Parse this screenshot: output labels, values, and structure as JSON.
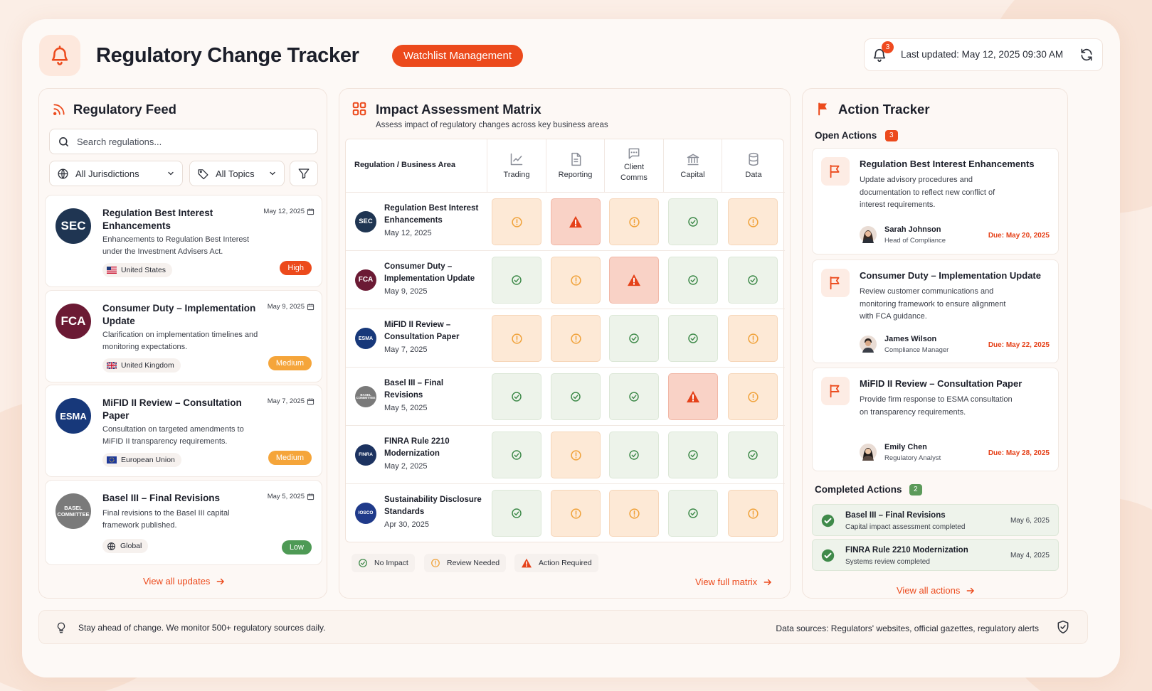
{
  "header": {
    "title": "Regulatory Change Tracker",
    "pill": "Watchlist Management",
    "notification_count": "3",
    "last_updated": "Last updated: May 12, 2025 09:30 AM"
  },
  "feed": {
    "title": "Regulatory Feed",
    "search_placeholder": "Search regulations...",
    "jurisdiction_filter": "All Jurisdictions",
    "topic_filter": "All Topics",
    "items": [
      {
        "logo": "SEC",
        "title": "Regulation Best Interest Enhancements",
        "date": "May 12, 2025",
        "desc": "Enhancements to Regulation Best Interest under the Investment Advisers Act.",
        "region": "United States",
        "severity": "High"
      },
      {
        "logo": "FCA",
        "title": "Consumer Duty – Implementation Update",
        "date": "May 9, 2025",
        "desc": "Clarification on implementation timelines and monitoring expectations.",
        "region": "United Kingdom",
        "severity": "Medium"
      },
      {
        "logo": "ESMA",
        "title": "MiFID II Review – Consultation Paper",
        "date": "May 7, 2025",
        "desc": "Consultation on targeted amendments to MiFID II transparency requirements.",
        "region": "European Union",
        "severity": "Medium"
      },
      {
        "logo": "BASEL COMMITTEE",
        "title": "Basel III – Final Revisions",
        "date": "May 5, 2025",
        "desc": "Final revisions to the Basel III capital framework published.",
        "region": "Global",
        "severity": "Low"
      }
    ],
    "view_all": "View all updates"
  },
  "matrix": {
    "title": "Impact Assessment Matrix",
    "subtitle": "Assess impact of regulatory changes across key business areas",
    "corner_header": "Regulation / Business Area",
    "columns": [
      {
        "label": "Trading",
        "icon": "trend-icon"
      },
      {
        "label": "Reporting",
        "icon": "document-icon"
      },
      {
        "label": "Client Comms",
        "icon": "chat-icon"
      },
      {
        "label": "Capital",
        "icon": "bank-icon"
      },
      {
        "label": "Data",
        "icon": "database-icon"
      }
    ],
    "rows": [
      {
        "logo": "SEC",
        "name": "Regulation Best Interest Enhancements",
        "date": "May 12, 2025",
        "impacts": [
          "review",
          "action",
          "review",
          "none",
          "review"
        ]
      },
      {
        "logo": "FCA",
        "name": "Consumer Duty – Implementation Update",
        "date": "May 9, 2025",
        "impacts": [
          "none",
          "review",
          "action",
          "none",
          "none"
        ]
      },
      {
        "logo": "ESMA",
        "name": "MiFID II Review – Consultation Paper",
        "date": "May 7, 2025",
        "impacts": [
          "review",
          "review",
          "none",
          "none",
          "review"
        ]
      },
      {
        "logo": "BASEL COMMITTEE",
        "name": "Basel III – Final Revisions",
        "date": "May 5, 2025",
        "impacts": [
          "none",
          "none",
          "none",
          "action",
          "review"
        ]
      },
      {
        "logo": "FINRA",
        "name": "FINRA Rule 2210 Modernization",
        "date": "May 2, 2025",
        "impacts": [
          "none",
          "review",
          "none",
          "none",
          "none"
        ]
      },
      {
        "logo": "IOSCO",
        "name": "Sustainability Disclosure Standards",
        "date": "Apr 30, 2025",
        "impacts": [
          "none",
          "review",
          "review",
          "none",
          "review"
        ]
      }
    ],
    "legend": {
      "none": "No Impact",
      "review": "Review Needed",
      "action": "Action Required"
    },
    "view_full": "View full matrix"
  },
  "actions": {
    "title": "Action Tracker",
    "open_label": "Open Actions",
    "open_count": "3",
    "open": [
      {
        "title": "Regulation Best Interest Enhancements",
        "desc": "Update advisory procedures and documentation to reflect new conflict of interest requirements.",
        "person": "Sarah Johnson",
        "role": "Head of Compliance",
        "due": "Due: May 20, 2025"
      },
      {
        "title": "Consumer Duty – Implementation Update",
        "desc": "Review customer communications and monitoring framework to ensure alignment with FCA guidance.",
        "person": "James Wilson",
        "role": "Compliance Manager",
        "due": "Due: May 22, 2025"
      },
      {
        "title": "MiFID II Review – Consultation Paper",
        "desc": "Provide firm response to ESMA consultation on transparency requirements.",
        "person": "Emily Chen",
        "role": "Regulatory Analyst",
        "due": "Due: May 28, 2025"
      }
    ],
    "completed_label": "Completed Actions",
    "completed_count": "2",
    "completed": [
      {
        "title": "Basel III – Final Revisions",
        "sub": "Capital impact assessment completed",
        "date": "May 6, 2025"
      },
      {
        "title": "FINRA Rule 2210 Modernization",
        "sub": "Systems review completed",
        "date": "May 4, 2025"
      }
    ],
    "view_all": "View all actions"
  },
  "footer": {
    "tip": "Stay ahead of change. We monitor 500+ regulatory sources daily.",
    "sources": "Data sources:  Regulators' websites, official gazettes, regulatory alerts"
  },
  "colors": {
    "accent": "#ec4a1c",
    "high": "#ec4a1c",
    "medium": "#f5a53a",
    "low": "#4e9a55",
    "no_impact": "#3f8a4a",
    "review": "#f0a23a",
    "action": "#e5421a"
  }
}
